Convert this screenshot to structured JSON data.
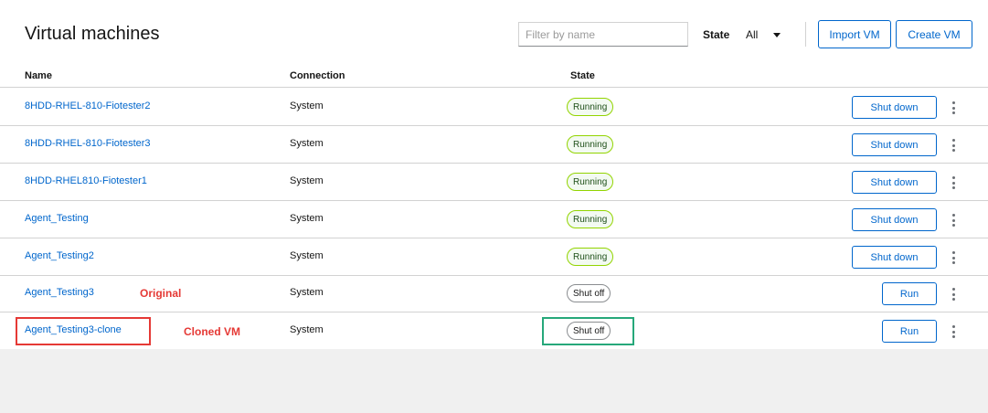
{
  "header": {
    "title": "Virtual machines",
    "filter_placeholder": "Filter by name",
    "state_label": "State",
    "state_value": "All",
    "import_label": "Import VM",
    "create_label": "Create VM"
  },
  "table": {
    "columns": [
      "Name",
      "Connection",
      "State"
    ],
    "rows": [
      {
        "name": "8HDD-RHEL-810-Fiotester2",
        "connection": "System",
        "state": "Running",
        "action": "Shut down"
      },
      {
        "name": "8HDD-RHEL-810-Fiotester3",
        "connection": "System",
        "state": "Running",
        "action": "Shut down"
      },
      {
        "name": "8HDD-RHEL810-Fiotester1",
        "connection": "System",
        "state": "Running",
        "action": "Shut down"
      },
      {
        "name": "Agent_Testing",
        "connection": "System",
        "state": "Running",
        "action": "Shut down"
      },
      {
        "name": "Agent_Testing2",
        "connection": "System",
        "state": "Running",
        "action": "Shut down"
      },
      {
        "name": "Agent_Testing3",
        "connection": "System",
        "state": "Shut off",
        "action": "Run"
      },
      {
        "name": "Agent_Testing3-clone",
        "connection": "System",
        "state": "Shut off",
        "action": "Run"
      }
    ]
  },
  "annotations": {
    "original": "Original",
    "cloned": "Cloned VM"
  },
  "colors": {
    "link": "#0066cc",
    "running_border": "#92d400",
    "annotation_red": "#e53935",
    "annotation_green": "#26a87a"
  }
}
